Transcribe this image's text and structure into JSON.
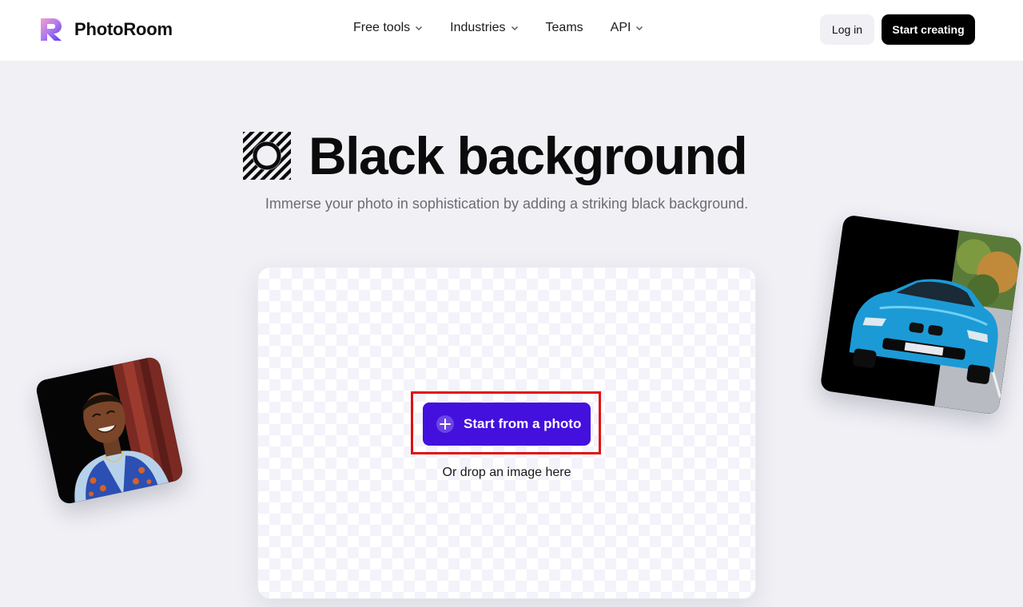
{
  "header": {
    "brand": "PhotoRoom",
    "nav": [
      {
        "label": "Free tools",
        "has_dropdown": true
      },
      {
        "label": "Industries",
        "has_dropdown": true
      },
      {
        "label": "Teams",
        "has_dropdown": false
      },
      {
        "label": "API",
        "has_dropdown": true
      }
    ],
    "login_label": "Log in",
    "cta_label": "Start creating"
  },
  "hero": {
    "title": "Black background",
    "subtitle": "Immerse your photo in sophistication by adding a striking black background.",
    "icon": "striped-circle-icon"
  },
  "upload": {
    "button_label": "Start from a photo",
    "button_icon": "plus-icon",
    "drop_hint": "Or drop an image here"
  },
  "examples": [
    {
      "name": "woman-portrait-on-black"
    },
    {
      "name": "blue-car-half-black-background"
    }
  ],
  "colors": {
    "page_bg": "#f0f0f5",
    "accent": "#4310de",
    "cta_bg": "#000000",
    "highlight": "#e01010"
  }
}
